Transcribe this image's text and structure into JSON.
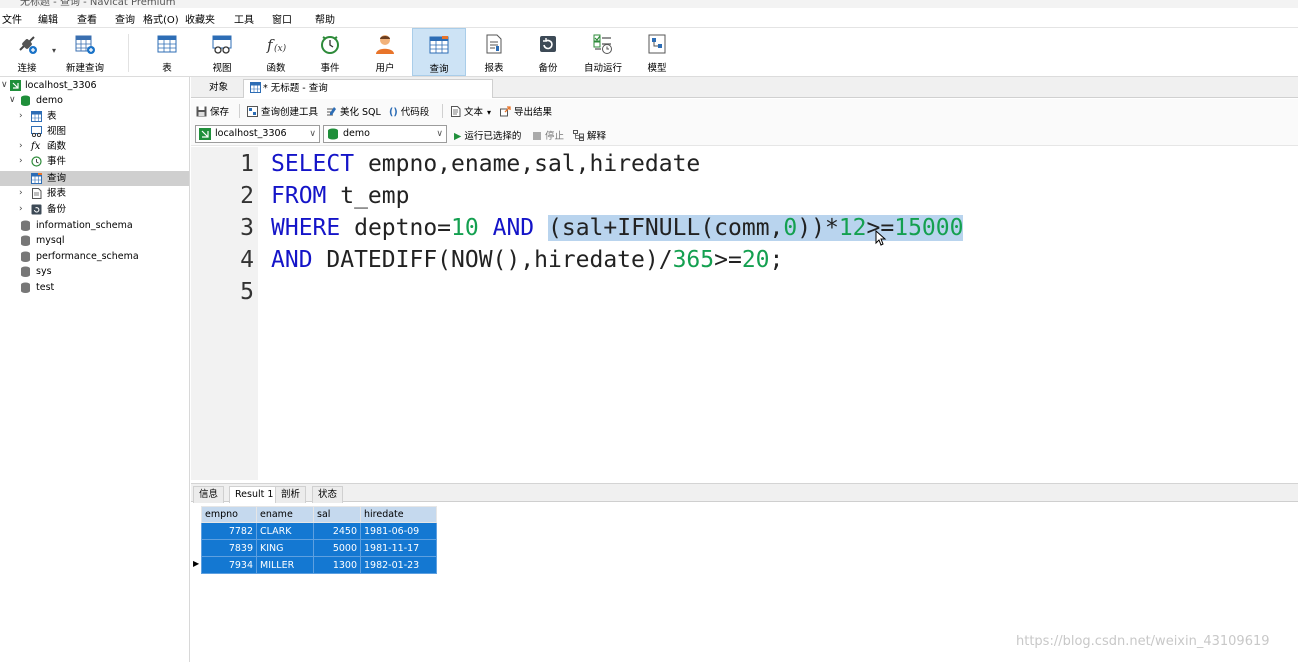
{
  "window": {
    "title": "无标题 - 查询 - Navicat Premium"
  },
  "menu": [
    "文件",
    "编辑",
    "查看",
    "查询",
    "格式(O)",
    "收藏夹",
    "工具",
    "窗口",
    "帮助"
  ],
  "toolbar": {
    "buttons": [
      {
        "label": "连接",
        "icon": "plug-icon"
      },
      {
        "label": "新建查询",
        "icon": "new-query-icon"
      },
      {
        "label": "表",
        "icon": "table-icon"
      },
      {
        "label": "视图",
        "icon": "view-icon"
      },
      {
        "label": "函数",
        "icon": "function-icon"
      },
      {
        "label": "事件",
        "icon": "clock-icon"
      },
      {
        "label": "用户",
        "icon": "user-icon"
      },
      {
        "label": "查询",
        "icon": "query-icon"
      },
      {
        "label": "报表",
        "icon": "report-icon"
      },
      {
        "label": "备份",
        "icon": "backup-icon"
      },
      {
        "label": "自动运行",
        "icon": "automation-icon"
      },
      {
        "label": "模型",
        "icon": "model-icon"
      }
    ],
    "active": "查询"
  },
  "sidebar": {
    "connection": "localhost_3306",
    "database": "demo",
    "demo_items": [
      "表",
      "视图",
      "函数",
      "事件",
      "查询",
      "报表",
      "备份"
    ],
    "other_databases": [
      "information_schema",
      "mysql",
      "performance_schema",
      "sys",
      "test"
    ],
    "selected": "查询"
  },
  "tabs": {
    "objects": "对象",
    "query": "* 无标题 - 查询"
  },
  "query_toolbar": {
    "save": "保存",
    "builder": "查询创建工具",
    "beautify": "美化 SQL",
    "snippet": "代码段",
    "text": "文本",
    "export": "导出结果"
  },
  "connection_bar": {
    "connection": "localhost_3306",
    "database": "demo",
    "run": "运行已选择的",
    "stop": "停止",
    "explain": "解释"
  },
  "editor": {
    "line_numbers": [
      "1",
      "2",
      "3",
      "4",
      "5"
    ],
    "lines": [
      [
        {
          "t": "SELECT",
          "c": "kw"
        },
        {
          "t": " empno,ename,sal,hiredate",
          "c": ""
        }
      ],
      [
        {
          "t": "FROM",
          "c": "kw"
        },
        {
          "t": " t_emp",
          "c": ""
        }
      ],
      [
        {
          "t": "WHERE",
          "c": "kw"
        },
        {
          "t": " deptno=",
          "c": ""
        },
        {
          "t": "10",
          "c": "nm"
        },
        {
          "t": " ",
          "c": ""
        },
        {
          "t": "AND",
          "c": "kw"
        },
        {
          "t": " ",
          "c": ""
        },
        {
          "t": "(sal+IFNULL(comm,",
          "c": "hl"
        },
        {
          "t": "0",
          "c": "hl nm"
        },
        {
          "t": "))*",
          "c": "hl"
        },
        {
          "t": "12",
          "c": "hl nm"
        },
        {
          "t": ">=",
          "c": "hl"
        },
        {
          "t": "15000",
          "c": "hl nm"
        }
      ],
      [
        {
          "t": "AND",
          "c": "kw"
        },
        {
          "t": " DATEDIFF(NOW(),hiredate)/",
          "c": ""
        },
        {
          "t": "365",
          "c": "nm"
        },
        {
          "t": ">=",
          "c": ""
        },
        {
          "t": "20",
          "c": "nm"
        },
        {
          "t": ";",
          "c": ""
        }
      ],
      []
    ]
  },
  "results": {
    "tabs": [
      "信息",
      "Result 1",
      "剖析",
      "状态"
    ],
    "active_tab": "Result 1",
    "columns": [
      "empno",
      "ename",
      "sal",
      "hiredate"
    ],
    "rows": [
      [
        "7782",
        "CLARK",
        "2450",
        "1981-06-09"
      ],
      [
        "7839",
        "KING",
        "5000",
        "1981-11-17"
      ],
      [
        "7934",
        "MILLER",
        "1300",
        "1982-01-23"
      ]
    ]
  },
  "watermark": "https://blog.csdn.net/weixin_43109619"
}
